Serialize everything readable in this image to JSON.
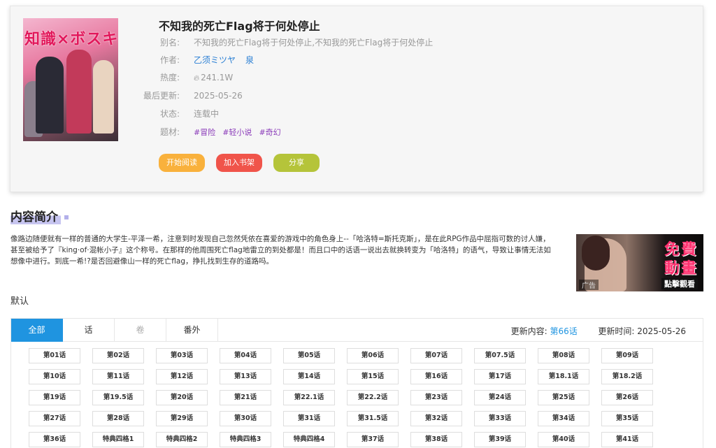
{
  "manga": {
    "title": "不知我的死亡Flag将于何处停止",
    "alias_label": "别名:",
    "alias": "不知我的死亡Flag将于何处停止,不知我的死亡Flag将于何处停止",
    "author_label": "作者:",
    "authors": [
      "乙须ミツヤ",
      "泉"
    ],
    "heat_label": "热度:",
    "heat": "241.1W",
    "updated_label": "最后更新:",
    "updated": "2025-05-26",
    "status_label": "状态:",
    "status": "连载中",
    "genre_label": "题材:",
    "tags": [
      "#冒险",
      "#轻小说",
      "#奇幻"
    ],
    "cover_text": "知識×ボスキャ"
  },
  "actions": {
    "read": "开始阅读",
    "shelf": "加入书架",
    "share": "分享"
  },
  "intro": {
    "heading": "内容简介",
    "text": "像路边随便就有一样的普通的大学生-平泽一希，注意到时发现自己忽然凭依在喜爱的游戏中的角色身上--「哈洛特=斯托克斯」，是在此RPG作品中屈指可数的讨人嫌，甚至被给予了『king·of·混帐小子』这个称号。在那样的他周围死亡flag地雷立的到处都是！而且口中的话语一说出去就换转变为「哈洛特」的语气，导致让事情无法如想像中进行。到底一希!?是否回避像山一样的死亡flag，挣扎找到生存的道路吗。"
  },
  "ad": {
    "line1": "免費",
    "line2": "動畫",
    "line3": "點擊觀看",
    "badge": "广告"
  },
  "default_label": "默认",
  "chapter_panel": {
    "tabs": [
      "全部",
      "话",
      "卷",
      "番外"
    ],
    "update_content_label": "更新内容:",
    "update_content": "第66话",
    "update_time_label": "更新时间:",
    "update_time": "2025-05-26",
    "chapters": [
      "第01话",
      "第02话",
      "第03话",
      "第04话",
      "第05话",
      "第06话",
      "第07话",
      "第07.5话",
      "第08话",
      "第09话",
      "第10话",
      "第11话",
      "第12话",
      "第13话",
      "第14话",
      "第15话",
      "第16话",
      "第17话",
      "第18.1话",
      "第18.2话",
      "第19话",
      "第19.5话",
      "第20话",
      "第21话",
      "第22.1话",
      "第22.2话",
      "第23话",
      "第24话",
      "第25话",
      "第26话",
      "第27话",
      "第28话",
      "第29话",
      "第30话",
      "第31话",
      "第31.5话",
      "第32话",
      "第33话",
      "第34话",
      "第35话",
      "第36话",
      "特典四格1",
      "特典四格2",
      "特典四格3",
      "特典四格4",
      "第37话",
      "第38话",
      "第39话",
      "第40话",
      "第41话"
    ]
  },
  "colors": {
    "accent": "#1f94e0",
    "read_button": "#f9b13c",
    "shelf_button": "#f0544a",
    "share_button": "#b5c43a",
    "tag": "#8a3ab9",
    "link": "#2a7fd4"
  }
}
